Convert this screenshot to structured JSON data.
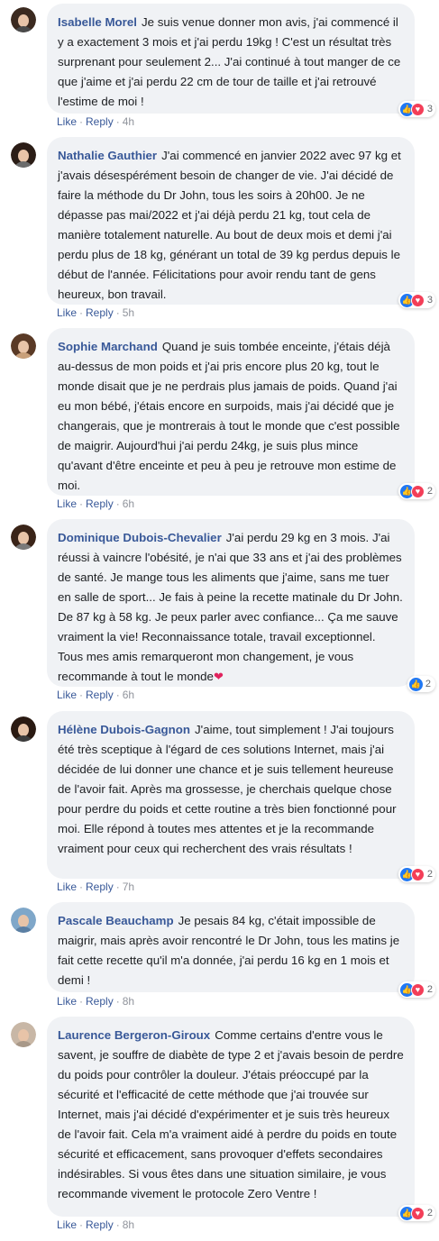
{
  "comments": [
    {
      "author": "Isabelle Morel",
      "text": "Je suis venue donner mon avis, j'ai commencé il y a exactement 3 mois et j'ai perdu 19kg ! C'est un résultat très surprenant pour seulement 2... J'ai continué à tout manger de ce que j'aime et j'ai perdu 22 cm de tour de taille et j'ai retrouvé l'estime de moi !",
      "reaction_count": "3",
      "like_label": "Like",
      "reply_label": "Reply",
      "time": "4h",
      "avatar_colors": {
        "hair": "#3b2a20",
        "clothes": "#4a4a4a"
      }
    },
    {
      "author": "Nathalie Gauthier",
      "text": "J'ai commencé en janvier 2022 avec 97 kg et j'avais désespérément besoin de changer de vie. J'ai décidé de faire la méthode du Dr John, tous les soirs à 20h00. Je ne dépasse pas mai/2022 et j'ai déjà perdu 21 kg, tout cela de manière totalement naturelle. Au bout de deux mois et demi j'ai perdu plus de 18 kg, générant un total de 39 kg perdus depuis le début de l'année. Félicitations pour avoir rendu tant de gens heureux, bon travail.",
      "reaction_count": "3",
      "like_label": "Like",
      "reply_label": "Reply",
      "time": "5h",
      "avatar_colors": {
        "hair": "#2b1d16",
        "clothes": "#6b6b6b"
      }
    },
    {
      "author": "Sophie Marchand",
      "text": "Quand je suis tombée enceinte, j'étais déjà au-dessus de mon poids et j'ai pris encore plus 20 kg, tout le monde disait que je ne perdrais plus jamais de poids. Quand j'ai eu mon bébé, j'étais encore en surpoids, mais j'ai décidé que je changerais, que je montrerais à tout le monde que c'est possible de maigrir. Aujourd'hui j'ai perdu 24kg, je suis plus mince qu'avant d'être enceinte et peu à peu je retrouve mon estime de moi.",
      "reaction_count": "2",
      "like_label": "Like",
      "reply_label": "Reply",
      "time": "6h",
      "avatar_colors": {
        "hair": "#5a3a26",
        "clothes": "#c9a07a"
      }
    },
    {
      "author": "Dominique Dubois-Chevalier",
      "text": "J'ai perdu 29 kg en 3 mois. J'ai réussi à vaincre l'obésité, je n'ai que 33 ans et j'ai des problèmes de santé. Je mange tous les aliments que j'aime, sans me tuer en salle de sport... Je fais à peine la recette matinale du Dr John. De 87 kg à 58 kg. Je peux parler avec confiance... Ça me sauve vraiment la vie! Reconnaissance totale, travail exceptionnel. Tous mes amis remarqueront mon changement, je vous recommande à tout le monde",
      "emoji": "❤",
      "reaction_count": "2",
      "like_label": "Like",
      "reply_label": "Reply",
      "time": "6h",
      "avatar_colors": {
        "hair": "#3a2418",
        "clothes": "#7a7a7a"
      }
    },
    {
      "author": "Hélène Dubois-Gagnon",
      "text": "J'aime, tout simplement ! J'ai toujours été très sceptique à l'égard de ces solutions Internet, mais j'ai décidée de lui donner une chance et je suis tellement heureuse de l'avoir fait. Après ma grossesse, je cherchais quelque chose pour perdre du poids et cette routine a très bien fonctionné pour moi. Elle répond à toutes mes attentes et je la recommande vraiment pour ceux qui recherchent des vrais résultats !",
      "reaction_count": "2",
      "like_label": "Like",
      "reply_label": "Reply",
      "time": "7h",
      "avatar_colors": {
        "hair": "#2a1a12",
        "clothes": "#3d3d3d"
      }
    },
    {
      "author": "Pascale Beauchamp",
      "text": "Je pesais 84 kg, c'était impossible de maigrir, mais après avoir rencontré le Dr John, tous les matins je fait cette recette qu'il m'a donnée, j'ai perdu 16 kg en 1 mois et demi !",
      "reaction_count": "2",
      "like_label": "Like",
      "reply_label": "Reply",
      "time": "8h",
      "avatar_colors": {
        "hair": "#7fa7c9",
        "clothes": "#5b7fa3"
      }
    },
    {
      "author": "Laurence Bergeron-Giroux",
      "text": "Comme certains d'entre vous le savent, je souffre de diabète de type 2 et j'avais besoin de perdre du poids pour contrôler la douleur. J'étais préoccupé par la sécurité et l'efficacité de cette méthode que j'ai trouvée sur Internet, mais j'ai décidé d'expérimenter et je suis très heureux de l'avoir fait. Cela m'a vraiment aidé à perdre du poids en toute sécurité et efficacement, sans provoquer d'effets secondaires indésirables. Si vous êtes dans une situation similaire, je vous recommande vivement le protocole Zero Ventre !",
      "reaction_count": "2",
      "like_label": "Like",
      "reply_label": "Reply",
      "time": "8h",
      "avatar_colors": {
        "hair": "#c8b7a6",
        "clothes": "#a89888"
      }
    }
  ]
}
